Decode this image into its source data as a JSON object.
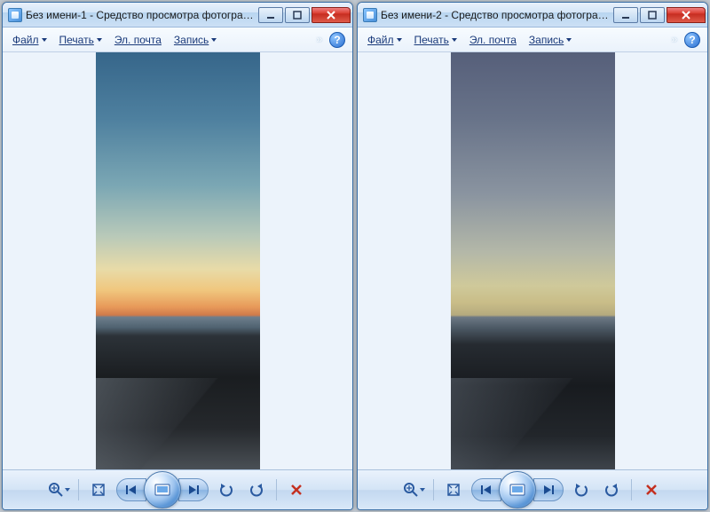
{
  "windows": [
    {
      "title": "Без имени-1 - Средство просмотра фотографий ...",
      "menu": {
        "file": "Файл",
        "print": "Печать",
        "email": "Эл. почта",
        "burn": "Запись"
      }
    },
    {
      "title": "Без имени-2 - Средство просмотра фотографий ...",
      "menu": {
        "file": "Файл",
        "print": "Печать",
        "email": "Эл. почта",
        "burn": "Запись"
      }
    }
  ],
  "help_symbol": "?",
  "icons": {
    "zoom": "zoom",
    "fit": "fit",
    "prev": "prev",
    "slideshow": "slideshow",
    "next": "next",
    "rotate_ccw": "rotate-ccw",
    "rotate_cw": "rotate-cw",
    "delete": "delete"
  }
}
